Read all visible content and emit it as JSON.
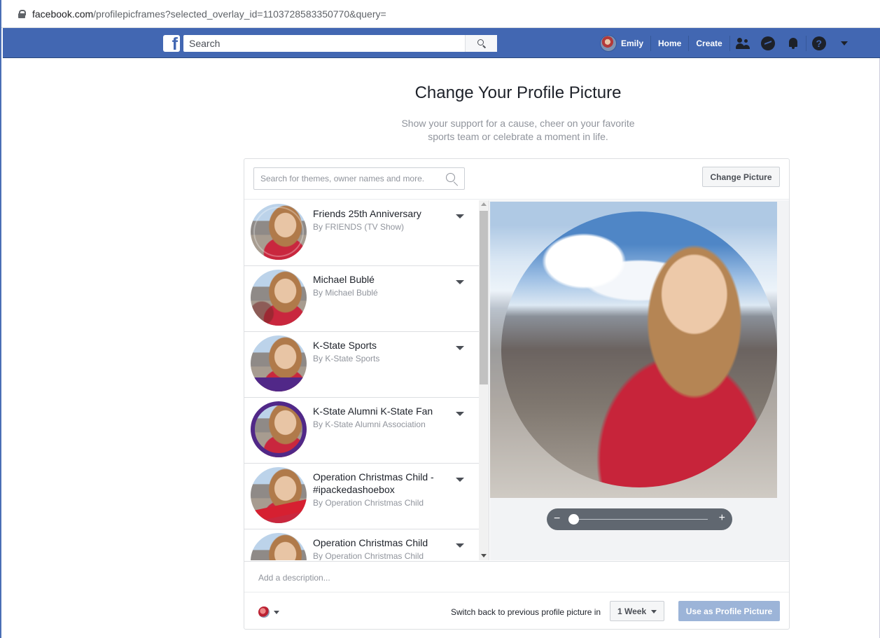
{
  "browser": {
    "url_host": "facebook.com",
    "url_path": "/profilepicframes?selected_overlay_id=1103728583350770&query="
  },
  "header": {
    "logo": "f",
    "search_placeholder": "Search",
    "user_name": "Emily",
    "home": "Home",
    "create": "Create",
    "help_glyph": "?",
    "icons": [
      "friends-icon",
      "messenger-icon",
      "notifications-icon",
      "help-icon",
      "account-menu-icon"
    ]
  },
  "page": {
    "title": "Change Your Profile Picture",
    "subtitle": "Show your support for a cause, cheer on your favorite sports team or celebrate a moment in life."
  },
  "card": {
    "search_placeholder": "Search for themes, owner names and more.",
    "change_picture": "Change Picture",
    "frames": [
      {
        "title": "Friends 25th Anniversary",
        "owner": "By FRIENDS (TV Show)"
      },
      {
        "title": "Michael Bublé",
        "owner": "By Michael Bublé"
      },
      {
        "title": "K-State Sports",
        "owner": "By K-State Sports"
      },
      {
        "title": "K-State Alumni K-State Fan",
        "owner": "By K-State Alumni Association"
      },
      {
        "title": "Operation Christmas Child - #ipackedashoebox",
        "owner": "By Operation Christmas Child"
      },
      {
        "title": "Operation Christmas Child",
        "owner": "By Operation Christmas Child"
      }
    ],
    "zoom": {
      "minus": "−",
      "plus": "+",
      "level": 0
    },
    "description_placeholder": "Add a description...",
    "switch_back_text": "Switch back to previous profile picture in",
    "duration": "1 Week",
    "use_button": "Use as Profile Picture"
  },
  "colors": {
    "fb_blue": "#4267b2",
    "button_disabled": "#9cb4d8"
  }
}
